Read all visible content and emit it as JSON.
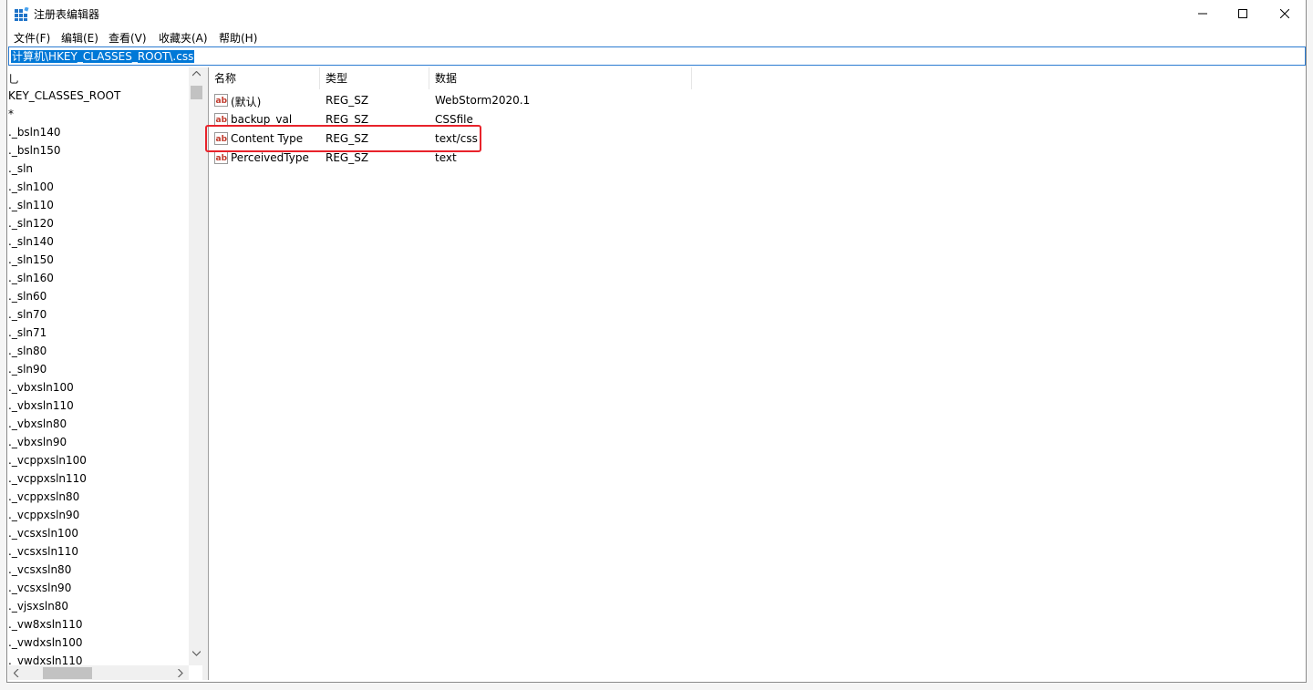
{
  "window": {
    "title": "注册表编辑器"
  },
  "menu": [
    "文件(F)",
    "编辑(E)",
    "查看(V)",
    "收藏夹(A)",
    "帮助(H)"
  ],
  "address": {
    "path": "计算机\\HKEY_CLASSES_ROOT\\.css"
  },
  "tree": {
    "items": [
      "乚",
      "KEY_CLASSES_ROOT",
      "*",
      "._bsln140",
      "._bsln150",
      "._sln",
      "._sln100",
      "._sln110",
      "._sln120",
      "._sln140",
      "._sln150",
      "._sln160",
      "._sln60",
      "._sln70",
      "._sln71",
      "._sln80",
      "._sln90",
      "._vbxsln100",
      "._vbxsln110",
      "._vbxsln80",
      "._vbxsln90",
      "._vcppxsln100",
      "._vcppxsln110",
      "._vcppxsln80",
      "._vcppxsln90",
      "._vcsxsln100",
      "._vcsxsln110",
      "._vcsxsln80",
      "._vcsxsln90",
      "._vjsxsln80",
      "._vw8xsln110",
      "._vwdxsln100",
      "._vwdxsln110"
    ]
  },
  "list": {
    "columns": [
      "名称",
      "类型",
      "数据"
    ],
    "rows": [
      {
        "name": "(默认)",
        "type": "REG_SZ",
        "data": "WebStorm2020.1"
      },
      {
        "name": "backup_val",
        "type": "REG_SZ",
        "data": "CSSfile"
      },
      {
        "name": "Content Type",
        "type": "REG_SZ",
        "data": "text/css"
      },
      {
        "name": "PerceivedType",
        "type": "REG_SZ",
        "data": "text"
      }
    ]
  },
  "colors": {
    "accent": "#0078d7",
    "highlight_box": "#e8232b"
  },
  "icons": {
    "app": "regedit-icon",
    "value": "reg-sz-ab-icon"
  }
}
